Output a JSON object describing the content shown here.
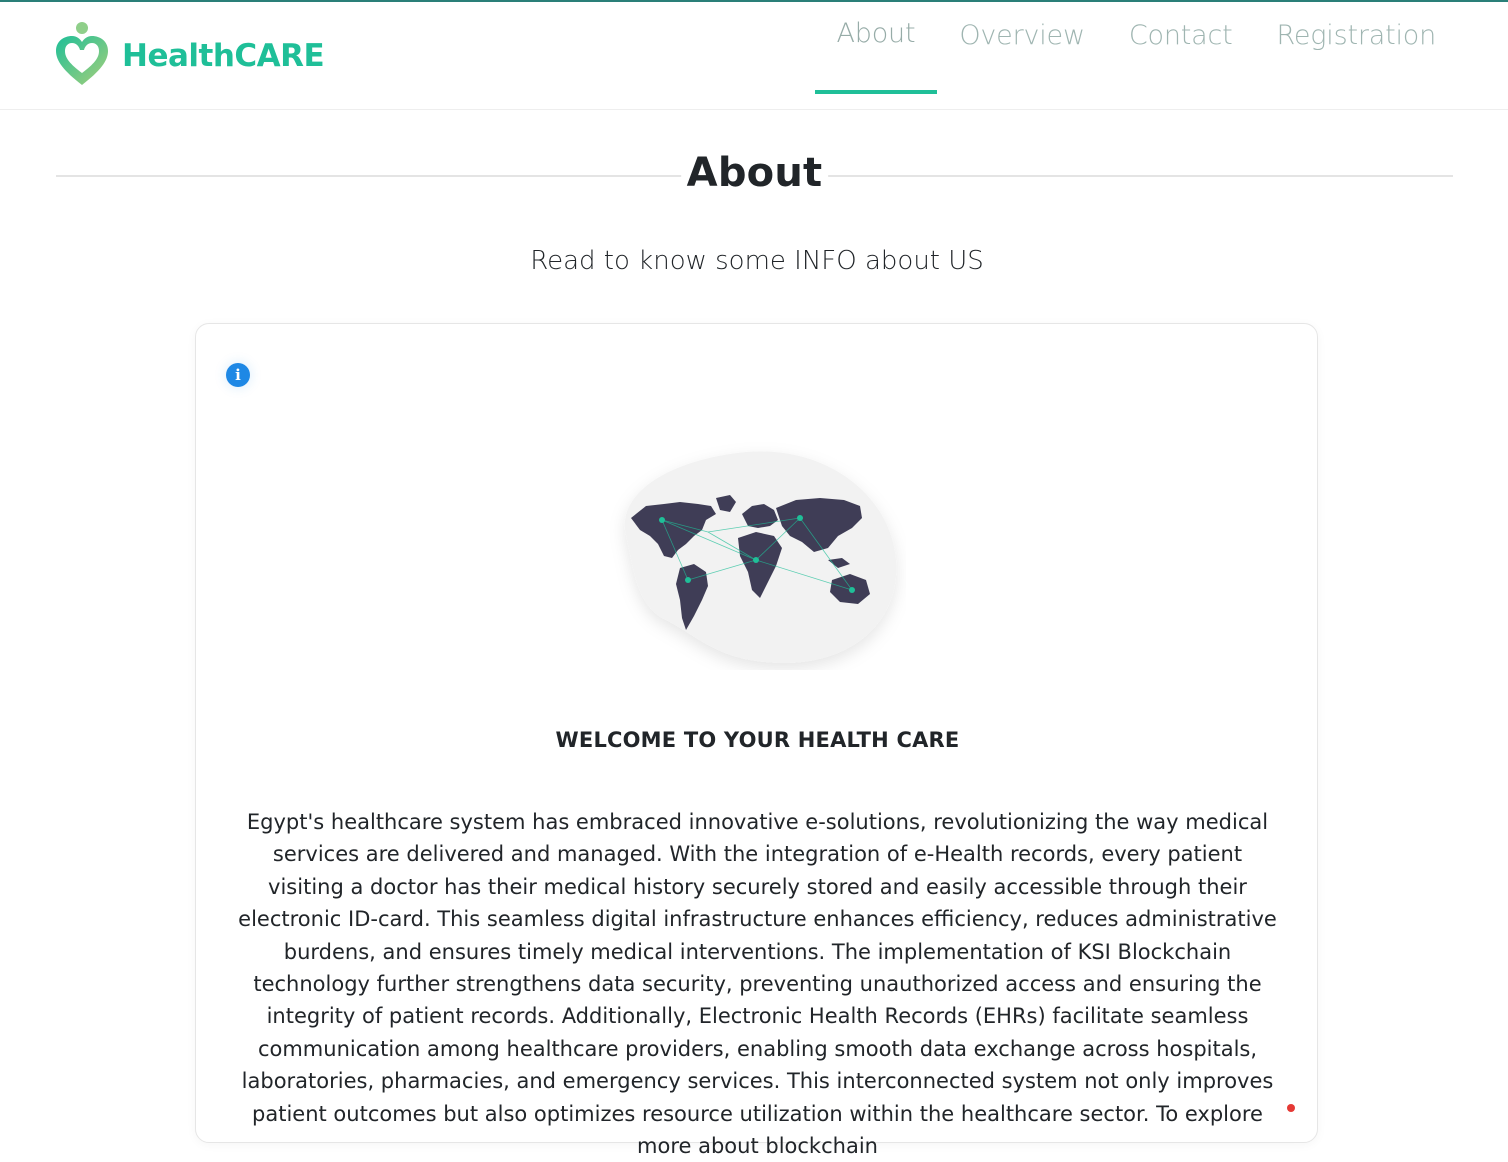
{
  "header": {
    "brand": {
      "name": "HealthCARE",
      "logo_icon": "heart-person-logo-icon",
      "colors": {
        "primary": "#1fbf98",
        "gradient_end": "#93c97a"
      }
    },
    "nav": [
      {
        "label": "About",
        "active": true
      },
      {
        "label": "Overview",
        "active": false
      },
      {
        "label": "Contact",
        "active": false
      },
      {
        "label": "Registration",
        "active": false
      }
    ]
  },
  "section": {
    "title": "About",
    "subtitle": "Read to know some INFO about US"
  },
  "card": {
    "info_icon": "info-icon",
    "illustration": "world-map-network-illustration",
    "heading": "WELCOME TO YOUR HEALTH CARE",
    "body": "Egypt's healthcare system has embraced innovative e-solutions, revolutionizing the way medical services are delivered and managed. With the integration of e-Health records, every patient visiting a doctor has their medical history securely stored and easily accessible through their electronic ID-card. This seamless digital infrastructure enhances efficiency, reduces administrative burdens, and ensures timely medical interventions. The implementation of KSI Blockchain technology further strengthens data security, preventing unauthorized access and ensuring the integrity of patient records. Additionally, Electronic Health Records (EHRs) facilitate seamless communication among healthcare providers, enabling smooth data exchange across hospitals, laboratories, pharmacies, and emergency services. This interconnected system not only improves patient outcomes but also optimizes resource utilization within the healthcare sector. To explore more about blockchain"
  },
  "colors": {
    "accent": "#1fbf98",
    "nav_text": "#9fb5b1",
    "info_blue": "#1e88e5",
    "map_land": "#3f3d56",
    "map_dot": "#1fbf98",
    "status_dot": "#e53935"
  }
}
